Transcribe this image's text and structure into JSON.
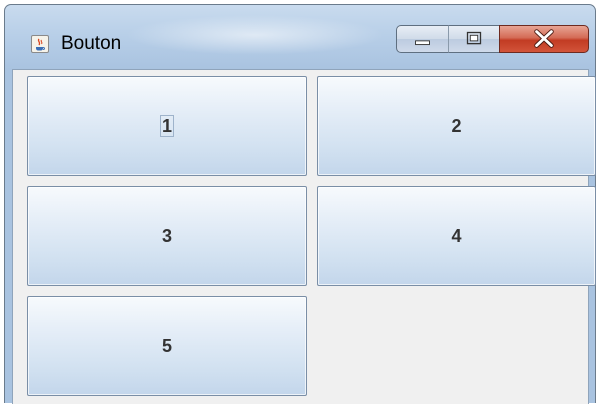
{
  "window": {
    "title": "Bouton",
    "icon": "java-cup-icon",
    "controls": [
      "minimize-icon",
      "maximize-icon",
      "close-icon"
    ]
  },
  "buttons": [
    {
      "label": "1",
      "focused": true
    },
    {
      "label": "2"
    },
    {
      "label": "3"
    },
    {
      "label": "4"
    },
    {
      "label": "5"
    }
  ],
  "colors": {
    "title_bar": "#b8cfe8",
    "client_bg": "#f0f0f0",
    "button_top": "#f7fafd",
    "button_bottom": "#c3d6eb",
    "button_border": "#7a8ea6",
    "close_button": "#c23b23",
    "label_text": "#333333"
  }
}
